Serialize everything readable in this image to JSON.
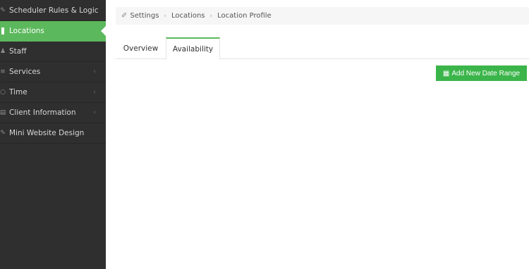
{
  "sidebar": {
    "items": [
      {
        "label": "Scheduler Rules & Logic",
        "icon": "wrench-icon",
        "glyph": "✎",
        "chevron": ""
      },
      {
        "label": "Locations",
        "icon": "location-icon",
        "glyph": "",
        "chevron": ""
      },
      {
        "label": "Staff",
        "icon": "staff-icon",
        "glyph": "♟",
        "chevron": ""
      },
      {
        "label": "Services",
        "icon": "services-icon",
        "glyph": "≡",
        "chevron": "‹"
      },
      {
        "label": "Time",
        "icon": "clock-icon",
        "glyph": "○",
        "chevron": "‹"
      },
      {
        "label": "Client Information",
        "icon": "clipboard-icon",
        "glyph": "▤",
        "chevron": "‹"
      },
      {
        "label": "Mini Website Design",
        "icon": "pencil-icon",
        "glyph": "✎",
        "chevron": ""
      }
    ],
    "active": "Locations"
  },
  "breadcrumb": {
    "icon_glyph": "✐",
    "items": [
      "Settings",
      "Locations",
      "Location Profile"
    ],
    "separator": "›"
  },
  "tabs": [
    {
      "label": "Overview"
    },
    {
      "label": "Availability"
    }
  ],
  "actions": {
    "add_date_range_icon": "▦",
    "add_date_range_label": "Add New Date Range"
  },
  "colors": {
    "accent": "#5cb85c",
    "button": "#3bb54a",
    "sidebar_bg": "#2f2f2f"
  }
}
